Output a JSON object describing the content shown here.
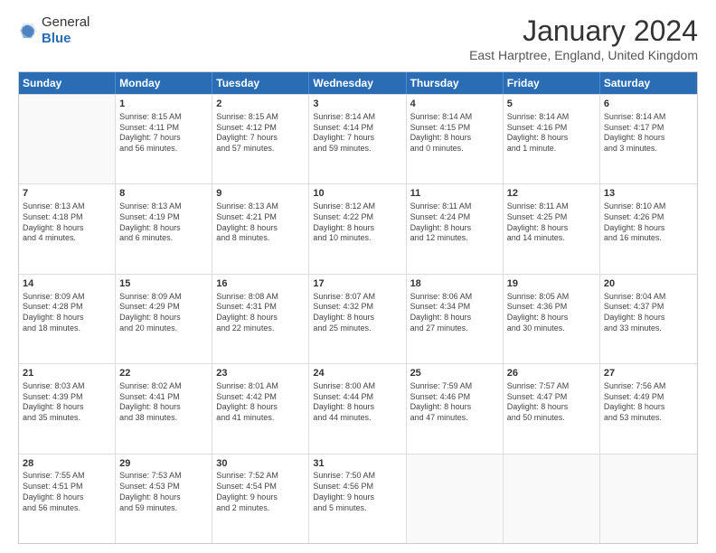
{
  "logo": {
    "general": "General",
    "blue": "Blue"
  },
  "header": {
    "title": "January 2024",
    "location": "East Harptree, England, United Kingdom"
  },
  "weekdays": [
    "Sunday",
    "Monday",
    "Tuesday",
    "Wednesday",
    "Thursday",
    "Friday",
    "Saturday"
  ],
  "rows": [
    [
      {
        "day": "",
        "lines": []
      },
      {
        "day": "1",
        "lines": [
          "Sunrise: 8:15 AM",
          "Sunset: 4:11 PM",
          "Daylight: 7 hours",
          "and 56 minutes."
        ]
      },
      {
        "day": "2",
        "lines": [
          "Sunrise: 8:15 AM",
          "Sunset: 4:12 PM",
          "Daylight: 7 hours",
          "and 57 minutes."
        ]
      },
      {
        "day": "3",
        "lines": [
          "Sunrise: 8:14 AM",
          "Sunset: 4:14 PM",
          "Daylight: 7 hours",
          "and 59 minutes."
        ]
      },
      {
        "day": "4",
        "lines": [
          "Sunrise: 8:14 AM",
          "Sunset: 4:15 PM",
          "Daylight: 8 hours",
          "and 0 minutes."
        ]
      },
      {
        "day": "5",
        "lines": [
          "Sunrise: 8:14 AM",
          "Sunset: 4:16 PM",
          "Daylight: 8 hours",
          "and 1 minute."
        ]
      },
      {
        "day": "6",
        "lines": [
          "Sunrise: 8:14 AM",
          "Sunset: 4:17 PM",
          "Daylight: 8 hours",
          "and 3 minutes."
        ]
      }
    ],
    [
      {
        "day": "7",
        "lines": [
          "Sunrise: 8:13 AM",
          "Sunset: 4:18 PM",
          "Daylight: 8 hours",
          "and 4 minutes."
        ]
      },
      {
        "day": "8",
        "lines": [
          "Sunrise: 8:13 AM",
          "Sunset: 4:19 PM",
          "Daylight: 8 hours",
          "and 6 minutes."
        ]
      },
      {
        "day": "9",
        "lines": [
          "Sunrise: 8:13 AM",
          "Sunset: 4:21 PM",
          "Daylight: 8 hours",
          "and 8 minutes."
        ]
      },
      {
        "day": "10",
        "lines": [
          "Sunrise: 8:12 AM",
          "Sunset: 4:22 PM",
          "Daylight: 8 hours",
          "and 10 minutes."
        ]
      },
      {
        "day": "11",
        "lines": [
          "Sunrise: 8:11 AM",
          "Sunset: 4:24 PM",
          "Daylight: 8 hours",
          "and 12 minutes."
        ]
      },
      {
        "day": "12",
        "lines": [
          "Sunrise: 8:11 AM",
          "Sunset: 4:25 PM",
          "Daylight: 8 hours",
          "and 14 minutes."
        ]
      },
      {
        "day": "13",
        "lines": [
          "Sunrise: 8:10 AM",
          "Sunset: 4:26 PM",
          "Daylight: 8 hours",
          "and 16 minutes."
        ]
      }
    ],
    [
      {
        "day": "14",
        "lines": [
          "Sunrise: 8:09 AM",
          "Sunset: 4:28 PM",
          "Daylight: 8 hours",
          "and 18 minutes."
        ]
      },
      {
        "day": "15",
        "lines": [
          "Sunrise: 8:09 AM",
          "Sunset: 4:29 PM",
          "Daylight: 8 hours",
          "and 20 minutes."
        ]
      },
      {
        "day": "16",
        "lines": [
          "Sunrise: 8:08 AM",
          "Sunset: 4:31 PM",
          "Daylight: 8 hours",
          "and 22 minutes."
        ]
      },
      {
        "day": "17",
        "lines": [
          "Sunrise: 8:07 AM",
          "Sunset: 4:32 PM",
          "Daylight: 8 hours",
          "and 25 minutes."
        ]
      },
      {
        "day": "18",
        "lines": [
          "Sunrise: 8:06 AM",
          "Sunset: 4:34 PM",
          "Daylight: 8 hours",
          "and 27 minutes."
        ]
      },
      {
        "day": "19",
        "lines": [
          "Sunrise: 8:05 AM",
          "Sunset: 4:36 PM",
          "Daylight: 8 hours",
          "and 30 minutes."
        ]
      },
      {
        "day": "20",
        "lines": [
          "Sunrise: 8:04 AM",
          "Sunset: 4:37 PM",
          "Daylight: 8 hours",
          "and 33 minutes."
        ]
      }
    ],
    [
      {
        "day": "21",
        "lines": [
          "Sunrise: 8:03 AM",
          "Sunset: 4:39 PM",
          "Daylight: 8 hours",
          "and 35 minutes."
        ]
      },
      {
        "day": "22",
        "lines": [
          "Sunrise: 8:02 AM",
          "Sunset: 4:41 PM",
          "Daylight: 8 hours",
          "and 38 minutes."
        ]
      },
      {
        "day": "23",
        "lines": [
          "Sunrise: 8:01 AM",
          "Sunset: 4:42 PM",
          "Daylight: 8 hours",
          "and 41 minutes."
        ]
      },
      {
        "day": "24",
        "lines": [
          "Sunrise: 8:00 AM",
          "Sunset: 4:44 PM",
          "Daylight: 8 hours",
          "and 44 minutes."
        ]
      },
      {
        "day": "25",
        "lines": [
          "Sunrise: 7:59 AM",
          "Sunset: 4:46 PM",
          "Daylight: 8 hours",
          "and 47 minutes."
        ]
      },
      {
        "day": "26",
        "lines": [
          "Sunrise: 7:57 AM",
          "Sunset: 4:47 PM",
          "Daylight: 8 hours",
          "and 50 minutes."
        ]
      },
      {
        "day": "27",
        "lines": [
          "Sunrise: 7:56 AM",
          "Sunset: 4:49 PM",
          "Daylight: 8 hours",
          "and 53 minutes."
        ]
      }
    ],
    [
      {
        "day": "28",
        "lines": [
          "Sunrise: 7:55 AM",
          "Sunset: 4:51 PM",
          "Daylight: 8 hours",
          "and 56 minutes."
        ]
      },
      {
        "day": "29",
        "lines": [
          "Sunrise: 7:53 AM",
          "Sunset: 4:53 PM",
          "Daylight: 8 hours",
          "and 59 minutes."
        ]
      },
      {
        "day": "30",
        "lines": [
          "Sunrise: 7:52 AM",
          "Sunset: 4:54 PM",
          "Daylight: 9 hours",
          "and 2 minutes."
        ]
      },
      {
        "day": "31",
        "lines": [
          "Sunrise: 7:50 AM",
          "Sunset: 4:56 PM",
          "Daylight: 9 hours",
          "and 5 minutes."
        ]
      },
      {
        "day": "",
        "lines": []
      },
      {
        "day": "",
        "lines": []
      },
      {
        "day": "",
        "lines": []
      }
    ]
  ]
}
